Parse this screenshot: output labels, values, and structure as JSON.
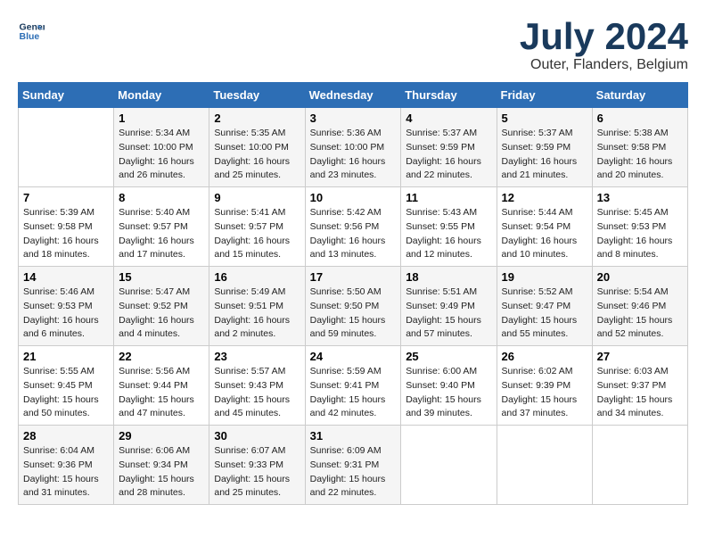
{
  "header": {
    "logo_line1": "General",
    "logo_line2": "Blue",
    "month": "July 2024",
    "location": "Outer, Flanders, Belgium"
  },
  "weekdays": [
    "Sunday",
    "Monday",
    "Tuesday",
    "Wednesday",
    "Thursday",
    "Friday",
    "Saturday"
  ],
  "weeks": [
    [
      {
        "day": "",
        "sunrise": "",
        "sunset": "",
        "daylight": ""
      },
      {
        "day": "1",
        "sunrise": "Sunrise: 5:34 AM",
        "sunset": "Sunset: 10:00 PM",
        "daylight": "Daylight: 16 hours and 26 minutes."
      },
      {
        "day": "2",
        "sunrise": "Sunrise: 5:35 AM",
        "sunset": "Sunset: 10:00 PM",
        "daylight": "Daylight: 16 hours and 25 minutes."
      },
      {
        "day": "3",
        "sunrise": "Sunrise: 5:36 AM",
        "sunset": "Sunset: 10:00 PM",
        "daylight": "Daylight: 16 hours and 23 minutes."
      },
      {
        "day": "4",
        "sunrise": "Sunrise: 5:37 AM",
        "sunset": "Sunset: 9:59 PM",
        "daylight": "Daylight: 16 hours and 22 minutes."
      },
      {
        "day": "5",
        "sunrise": "Sunrise: 5:37 AM",
        "sunset": "Sunset: 9:59 PM",
        "daylight": "Daylight: 16 hours and 21 minutes."
      },
      {
        "day": "6",
        "sunrise": "Sunrise: 5:38 AM",
        "sunset": "Sunset: 9:58 PM",
        "daylight": "Daylight: 16 hours and 20 minutes."
      }
    ],
    [
      {
        "day": "7",
        "sunrise": "Sunrise: 5:39 AM",
        "sunset": "Sunset: 9:58 PM",
        "daylight": "Daylight: 16 hours and 18 minutes."
      },
      {
        "day": "8",
        "sunrise": "Sunrise: 5:40 AM",
        "sunset": "Sunset: 9:57 PM",
        "daylight": "Daylight: 16 hours and 17 minutes."
      },
      {
        "day": "9",
        "sunrise": "Sunrise: 5:41 AM",
        "sunset": "Sunset: 9:57 PM",
        "daylight": "Daylight: 16 hours and 15 minutes."
      },
      {
        "day": "10",
        "sunrise": "Sunrise: 5:42 AM",
        "sunset": "Sunset: 9:56 PM",
        "daylight": "Daylight: 16 hours and 13 minutes."
      },
      {
        "day": "11",
        "sunrise": "Sunrise: 5:43 AM",
        "sunset": "Sunset: 9:55 PM",
        "daylight": "Daylight: 16 hours and 12 minutes."
      },
      {
        "day": "12",
        "sunrise": "Sunrise: 5:44 AM",
        "sunset": "Sunset: 9:54 PM",
        "daylight": "Daylight: 16 hours and 10 minutes."
      },
      {
        "day": "13",
        "sunrise": "Sunrise: 5:45 AM",
        "sunset": "Sunset: 9:53 PM",
        "daylight": "Daylight: 16 hours and 8 minutes."
      }
    ],
    [
      {
        "day": "14",
        "sunrise": "Sunrise: 5:46 AM",
        "sunset": "Sunset: 9:53 PM",
        "daylight": "Daylight: 16 hours and 6 minutes."
      },
      {
        "day": "15",
        "sunrise": "Sunrise: 5:47 AM",
        "sunset": "Sunset: 9:52 PM",
        "daylight": "Daylight: 16 hours and 4 minutes."
      },
      {
        "day": "16",
        "sunrise": "Sunrise: 5:49 AM",
        "sunset": "Sunset: 9:51 PM",
        "daylight": "Daylight: 16 hours and 2 minutes."
      },
      {
        "day": "17",
        "sunrise": "Sunrise: 5:50 AM",
        "sunset": "Sunset: 9:50 PM",
        "daylight": "Daylight: 15 hours and 59 minutes."
      },
      {
        "day": "18",
        "sunrise": "Sunrise: 5:51 AM",
        "sunset": "Sunset: 9:49 PM",
        "daylight": "Daylight: 15 hours and 57 minutes."
      },
      {
        "day": "19",
        "sunrise": "Sunrise: 5:52 AM",
        "sunset": "Sunset: 9:47 PM",
        "daylight": "Daylight: 15 hours and 55 minutes."
      },
      {
        "day": "20",
        "sunrise": "Sunrise: 5:54 AM",
        "sunset": "Sunset: 9:46 PM",
        "daylight": "Daylight: 15 hours and 52 minutes."
      }
    ],
    [
      {
        "day": "21",
        "sunrise": "Sunrise: 5:55 AM",
        "sunset": "Sunset: 9:45 PM",
        "daylight": "Daylight: 15 hours and 50 minutes."
      },
      {
        "day": "22",
        "sunrise": "Sunrise: 5:56 AM",
        "sunset": "Sunset: 9:44 PM",
        "daylight": "Daylight: 15 hours and 47 minutes."
      },
      {
        "day": "23",
        "sunrise": "Sunrise: 5:57 AM",
        "sunset": "Sunset: 9:43 PM",
        "daylight": "Daylight: 15 hours and 45 minutes."
      },
      {
        "day": "24",
        "sunrise": "Sunrise: 5:59 AM",
        "sunset": "Sunset: 9:41 PM",
        "daylight": "Daylight: 15 hours and 42 minutes."
      },
      {
        "day": "25",
        "sunrise": "Sunrise: 6:00 AM",
        "sunset": "Sunset: 9:40 PM",
        "daylight": "Daylight: 15 hours and 39 minutes."
      },
      {
        "day": "26",
        "sunrise": "Sunrise: 6:02 AM",
        "sunset": "Sunset: 9:39 PM",
        "daylight": "Daylight: 15 hours and 37 minutes."
      },
      {
        "day": "27",
        "sunrise": "Sunrise: 6:03 AM",
        "sunset": "Sunset: 9:37 PM",
        "daylight": "Daylight: 15 hours and 34 minutes."
      }
    ],
    [
      {
        "day": "28",
        "sunrise": "Sunrise: 6:04 AM",
        "sunset": "Sunset: 9:36 PM",
        "daylight": "Daylight: 15 hours and 31 minutes."
      },
      {
        "day": "29",
        "sunrise": "Sunrise: 6:06 AM",
        "sunset": "Sunset: 9:34 PM",
        "daylight": "Daylight: 15 hours and 28 minutes."
      },
      {
        "day": "30",
        "sunrise": "Sunrise: 6:07 AM",
        "sunset": "Sunset: 9:33 PM",
        "daylight": "Daylight: 15 hours and 25 minutes."
      },
      {
        "day": "31",
        "sunrise": "Sunrise: 6:09 AM",
        "sunset": "Sunset: 9:31 PM",
        "daylight": "Daylight: 15 hours and 22 minutes."
      },
      {
        "day": "",
        "sunrise": "",
        "sunset": "",
        "daylight": ""
      },
      {
        "day": "",
        "sunrise": "",
        "sunset": "",
        "daylight": ""
      },
      {
        "day": "",
        "sunrise": "",
        "sunset": "",
        "daylight": ""
      }
    ]
  ]
}
